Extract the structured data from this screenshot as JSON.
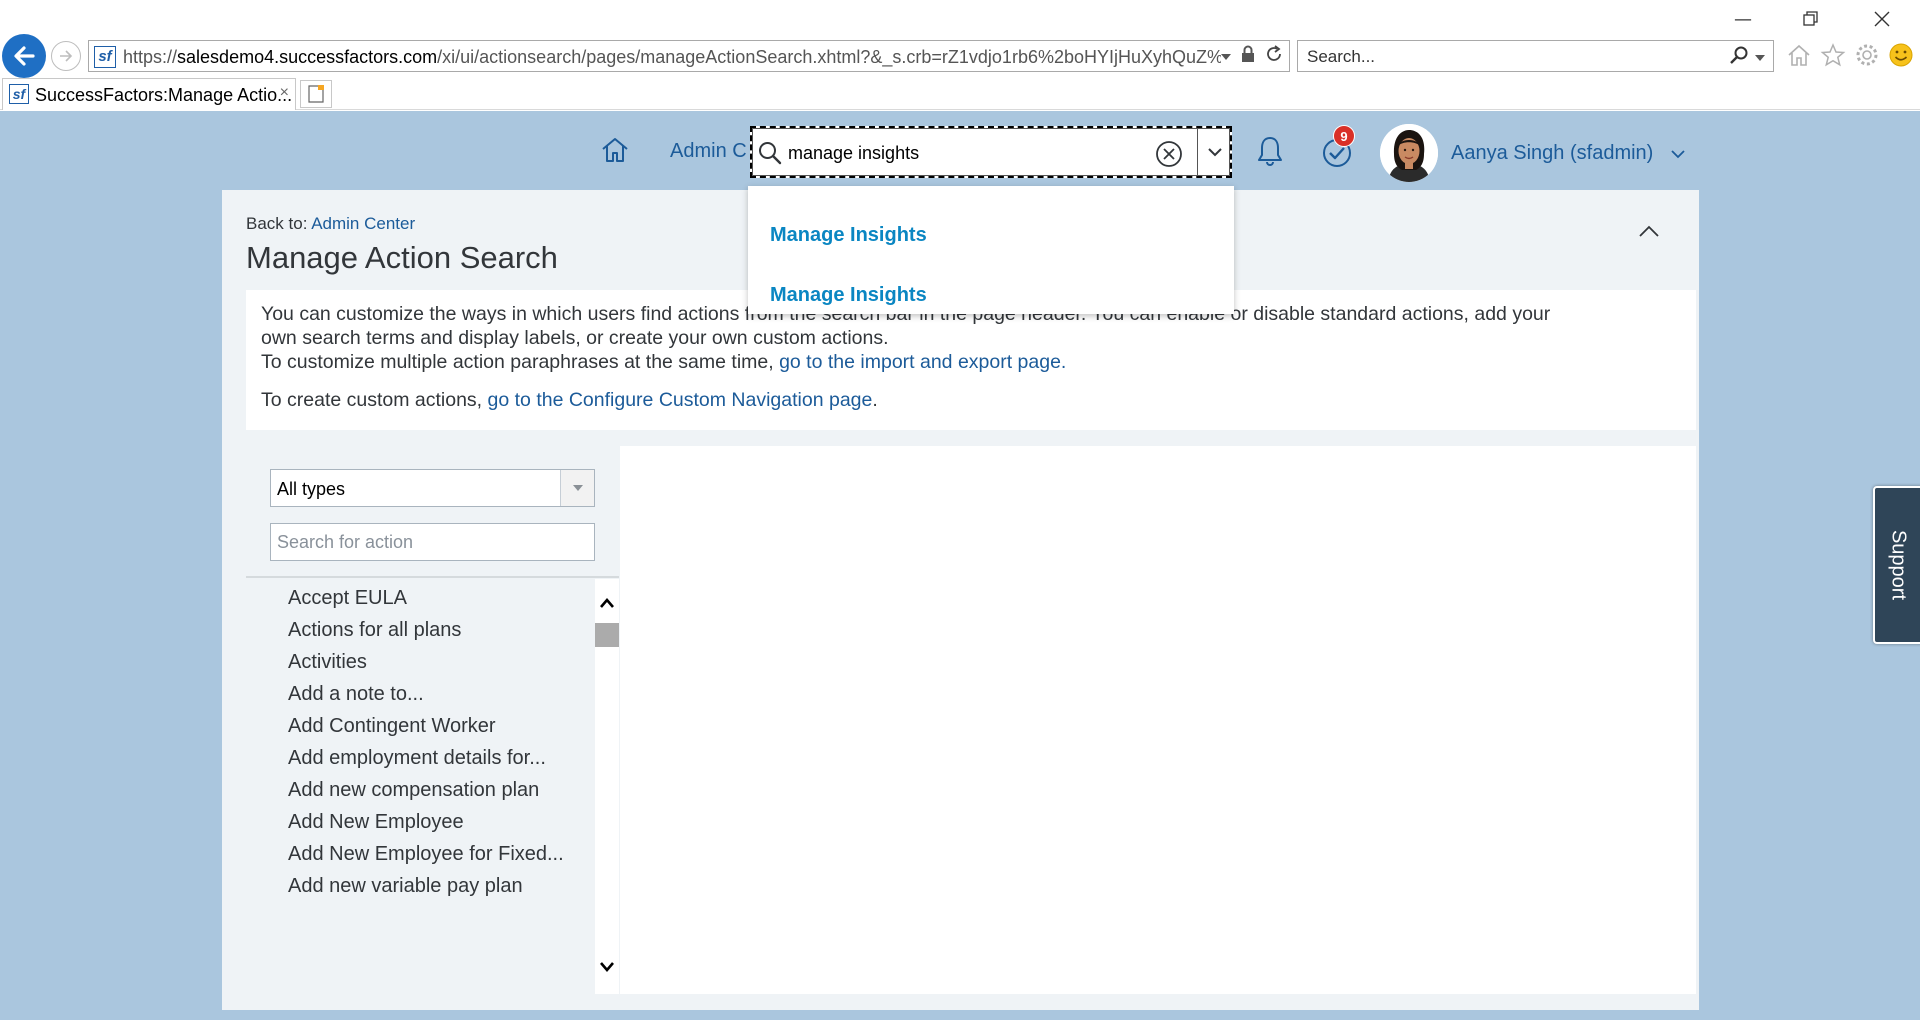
{
  "browser": {
    "url_proto": "https://",
    "url_host": "salesdemo4.successfactors.com",
    "url_rest": "/xi/ui/actionsearch/pages/manageActionSearch.xhtml?&_s.crb=rZ1vdjo1rb6%2boHYIjHuXyhQuZ%",
    "search_placeholder": "Search...",
    "tab_title": "SuccessFactors:Manage Actio...",
    "tab_close": "×",
    "favicon_text": "sf"
  },
  "shell": {
    "admin_link": "Admin C",
    "search_value": "manage insights",
    "notifications_count": "9",
    "user_name": "Aanya Singh (sfadmin)"
  },
  "suggestions": [
    "Manage Insights",
    "Manage Insights"
  ],
  "page": {
    "back_prefix": "Back to: ",
    "back_link": "Admin Center",
    "title": "Manage Action Search",
    "info_line1": "You can customize the ways in which users find actions from the search bar in the page header. You can enable or disable standard actions, add your",
    "info_line2": "own search terms and display labels, or create your own custom actions.",
    "info_line3_prefix": "To customize multiple action paraphrases at the same time, ",
    "info_line3_link": "go to the import and export page.",
    "info_line4_prefix": "To create custom actions, ",
    "info_line4_link": "go to the Configure Custom Navigation page",
    "info_line4_suffix": "."
  },
  "filter": {
    "type_value": "All types",
    "search_placeholder": "Search for action"
  },
  "actions": [
    "Accept EULA",
    "Actions for all plans",
    "Activities",
    "Add a note to...",
    "Add Contingent Worker",
    "Add employment details for...",
    "Add new compensation plan",
    "Add New Employee",
    "Add New Employee for Fixed...",
    "Add new variable pay plan"
  ],
  "support_label": "Support",
  "colors": {
    "shell_bg": "#aac6de",
    "link": "#1c5b99",
    "suggestion": "#0a86c2",
    "badge": "#d93027",
    "support_bg": "#2f4558"
  }
}
